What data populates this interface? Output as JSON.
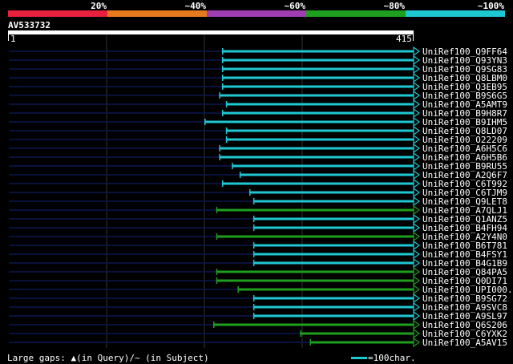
{
  "legend": {
    "segments": [
      {
        "label": "20%",
        "color": "#e8203c"
      },
      {
        "label": "~40%",
        "color": "#e87a1e"
      },
      {
        "label": "~60%",
        "color": "#a03cb4"
      },
      {
        "label": "~80%",
        "color": "#1ea01e"
      },
      {
        "label": "~100%",
        "color": "#1ec8d2"
      }
    ]
  },
  "query": {
    "name": "AV533732",
    "start": "1",
    "end": "415"
  },
  "hits": [
    {
      "name": "UniRef100_Q9FF64",
      "start": 220,
      "end": 415,
      "color": "#1ec8d2"
    },
    {
      "name": "UniRef100_Q93YN3",
      "start": 220,
      "end": 415,
      "color": "#1ec8d2"
    },
    {
      "name": "UniRef100_Q9SG83",
      "start": 220,
      "end": 415,
      "color": "#1ec8d2"
    },
    {
      "name": "UniRef100_Q8LBM0",
      "start": 220,
      "end": 415,
      "color": "#1ec8d2"
    },
    {
      "name": "UniRef100_Q3EB95",
      "start": 220,
      "end": 415,
      "color": "#1ec8d2"
    },
    {
      "name": "UniRef100_B9S6G5",
      "start": 217,
      "end": 415,
      "color": "#1ec8d2"
    },
    {
      "name": "UniRef100_A5AMT9",
      "start": 224,
      "end": 415,
      "color": "#1ec8d2"
    },
    {
      "name": "UniRef100_B9H8R7",
      "start": 220,
      "end": 415,
      "color": "#1ec8d2"
    },
    {
      "name": "UniRef100_B9IHM5",
      "start": 202,
      "end": 415,
      "color": "#1ec8d2"
    },
    {
      "name": "UniRef100_Q8LD07",
      "start": 224,
      "end": 415,
      "color": "#1ec8d2"
    },
    {
      "name": "UniRef100_O22209",
      "start": 224,
      "end": 415,
      "color": "#1ec8d2"
    },
    {
      "name": "UniRef100_A6H5C6",
      "start": 217,
      "end": 415,
      "color": "#1ec8d2"
    },
    {
      "name": "UniRef100_A6H5B6",
      "start": 217,
      "end": 415,
      "color": "#1ec8d2"
    },
    {
      "name": "UniRef100_B9RU55",
      "start": 230,
      "end": 415,
      "color": "#1ec8d2"
    },
    {
      "name": "UniRef100_A2Q6F7",
      "start": 238,
      "end": 415,
      "color": "#1ec8d2"
    },
    {
      "name": "UniRef100_C6T992",
      "start": 220,
      "end": 415,
      "color": "#1ec8d2"
    },
    {
      "name": "UniRef100_C6TJM9",
      "start": 248,
      "end": 415,
      "color": "#1ec8d2"
    },
    {
      "name": "UniRef100_Q9LET8",
      "start": 252,
      "end": 415,
      "color": "#1ec8d2"
    },
    {
      "name": "UniRef100_A7QLJ1",
      "start": 214,
      "end": 415,
      "color": "#1ea01e"
    },
    {
      "name": "UniRef100_Q1ANZ5",
      "start": 252,
      "end": 415,
      "color": "#1ec8d2"
    },
    {
      "name": "UniRef100_B4FH94",
      "start": 252,
      "end": 415,
      "color": "#1ec8d2"
    },
    {
      "name": "UniRef100_A2Y4N0",
      "start": 214,
      "end": 415,
      "color": "#1ea01e"
    },
    {
      "name": "UniRef100_B6T781",
      "start": 252,
      "end": 415,
      "color": "#1ec8d2"
    },
    {
      "name": "UniRef100_B4FSY1",
      "start": 252,
      "end": 415,
      "color": "#1ec8d2"
    },
    {
      "name": "UniRef100_B4G1B9",
      "start": 252,
      "end": 415,
      "color": "#1ec8d2"
    },
    {
      "name": "UniRef100_Q84PA5",
      "start": 214,
      "end": 415,
      "color": "#1ea01e"
    },
    {
      "name": "UniRef100_Q0DI71",
      "start": 214,
      "end": 415,
      "color": "#1ea01e"
    },
    {
      "name": "UniRef100_UPI000..",
      "start": 236,
      "end": 415,
      "color": "#1ea01e"
    },
    {
      "name": "UniRef100_B9SG72",
      "start": 252,
      "end": 415,
      "color": "#1ec8d2"
    },
    {
      "name": "UniRef100_A9SVC8",
      "start": 252,
      "end": 415,
      "color": "#1ec8d2"
    },
    {
      "name": "UniRef100_A9SL97",
      "start": 252,
      "end": 415,
      "color": "#1ec8d2"
    },
    {
      "name": "UniRef100_Q6S206",
      "start": 211,
      "end": 415,
      "color": "#1ea01e"
    },
    {
      "name": "UniRef100_C6YXK2",
      "start": 300,
      "end": 415,
      "color": "#1ea01e"
    },
    {
      "name": "UniRef100_A5AV15",
      "start": 310,
      "end": 415,
      "color": "#1ea01e"
    }
  ],
  "footer": {
    "gaps_text": "Large gaps: ▲(in Query)/~ (in Subject)",
    "scale_text": "=100char."
  }
}
